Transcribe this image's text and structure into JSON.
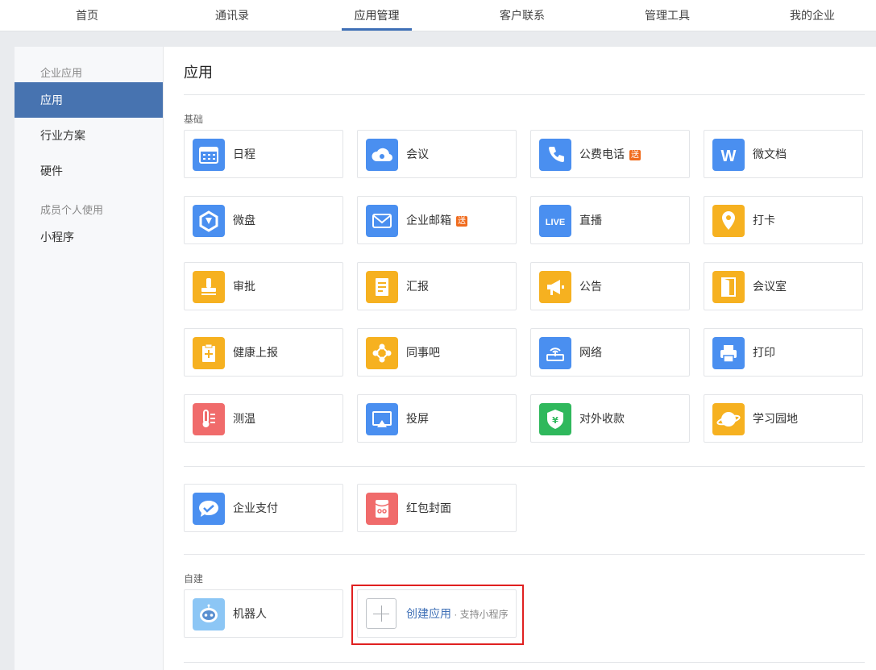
{
  "topnav": {
    "items": [
      "首页",
      "通讯录",
      "应用管理",
      "客户联系",
      "管理工具",
      "我的企业"
    ],
    "active_index": 2
  },
  "sidebar": {
    "group1": "企业应用",
    "items1": [
      "应用",
      "行业方案",
      "硬件"
    ],
    "group2": "成员个人使用",
    "items2": [
      "小程序"
    ],
    "active": "应用"
  },
  "content": {
    "title": "应用",
    "section_basic": "基础",
    "basic_apps": [
      {
        "name": "日程",
        "icon": "calendar-icon",
        "color": "#4a8ff0"
      },
      {
        "name": "会议",
        "icon": "cloud-meeting-icon",
        "color": "#4a8ff0"
      },
      {
        "name": "公费电话",
        "icon": "phone-icon",
        "color": "#4a8ff0",
        "badge": "送"
      },
      {
        "name": "微文档",
        "icon": "w-doc-icon",
        "color": "#4a8ff0"
      },
      {
        "name": "微盘",
        "icon": "drive-icon",
        "color": "#4a8ff0"
      },
      {
        "name": "企业邮箱",
        "icon": "mail-icon",
        "color": "#4a8ff0",
        "badge": "送"
      },
      {
        "name": "直播",
        "icon": "live-icon",
        "color": "#4a8ff0"
      },
      {
        "name": "打卡",
        "icon": "location-pin-icon",
        "color": "#f6b120"
      },
      {
        "name": "审批",
        "icon": "stamp-icon",
        "color": "#f6b120"
      },
      {
        "name": "汇报",
        "icon": "report-icon",
        "color": "#f6b120"
      },
      {
        "name": "公告",
        "icon": "megaphone-icon",
        "color": "#f6b120"
      },
      {
        "name": "会议室",
        "icon": "door-icon",
        "color": "#f6b120"
      },
      {
        "name": "健康上报",
        "icon": "health-clipboard-icon",
        "color": "#f6b120"
      },
      {
        "name": "同事吧",
        "icon": "network-icon",
        "color": "#f6b120"
      },
      {
        "name": "网络",
        "icon": "router-icon",
        "color": "#4a8ff0"
      },
      {
        "name": "打印",
        "icon": "printer-icon",
        "color": "#4a8ff0"
      },
      {
        "name": "测温",
        "icon": "thermometer-icon",
        "color": "#f06b6b"
      },
      {
        "name": "投屏",
        "icon": "screen-cast-icon",
        "color": "#4a8ff0"
      },
      {
        "name": "对外收款",
        "icon": "yuan-shield-icon",
        "color": "#2fb85c"
      },
      {
        "name": "学习园地",
        "icon": "planet-icon",
        "color": "#f6b120"
      }
    ],
    "pay_apps": [
      {
        "name": "企业支付",
        "icon": "pay-bubble-icon",
        "color": "#4a8ff0"
      },
      {
        "name": "红包封面",
        "icon": "red-packet-icon",
        "color": "#f06b6b"
      }
    ],
    "section_custom": "自建",
    "custom_apps": [
      {
        "name": "机器人",
        "icon": "robot-icon",
        "color": "#8cc6f5"
      }
    ],
    "create": {
      "label": "创建应用",
      "sub": " · 支持小程序"
    }
  }
}
